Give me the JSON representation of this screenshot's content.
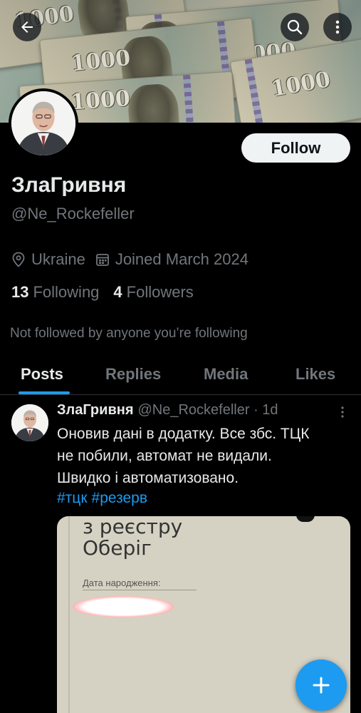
{
  "header": {
    "back_icon": "arrow-left-icon",
    "search_icon": "search-icon",
    "more_icon": "more-vertical-icon",
    "banner_text": "1000"
  },
  "profile": {
    "display_name": "ЗлаГривня",
    "handle": "@Ne_Rockefeller",
    "follow_label": "Follow",
    "location": "Ukraine",
    "joined": "Joined March 2024",
    "following_count": "13",
    "following_label": "Following",
    "followers_count": "4",
    "followers_label": "Followers",
    "not_followed_text": "Not followed by anyone you’re following"
  },
  "tabs": [
    {
      "label": "Posts",
      "active": true
    },
    {
      "label": "Replies",
      "active": false
    },
    {
      "label": "Media",
      "active": false
    },
    {
      "label": "Likes",
      "active": false
    }
  ],
  "post": {
    "name": "ЗлаГривня",
    "handle_time": "@Ne_Rockefeller · 1d",
    "lines": [
      "Оновив дані в додатку. Все збс. ТЦК",
      "не побили, автомат не видали.",
      "Швидко і автоматизовано."
    ],
    "hashtags": [
      "#тцк",
      "#резерв"
    ],
    "media": {
      "title_line1": "з реєстру",
      "title_line2": "Оберіг",
      "field_label": "Дата народження:"
    }
  },
  "fab_icon": "plus-icon",
  "colors": {
    "accent": "#1d9bf0",
    "background": "#000000",
    "text_primary": "#e7e9ea",
    "text_secondary": "#71767b"
  }
}
